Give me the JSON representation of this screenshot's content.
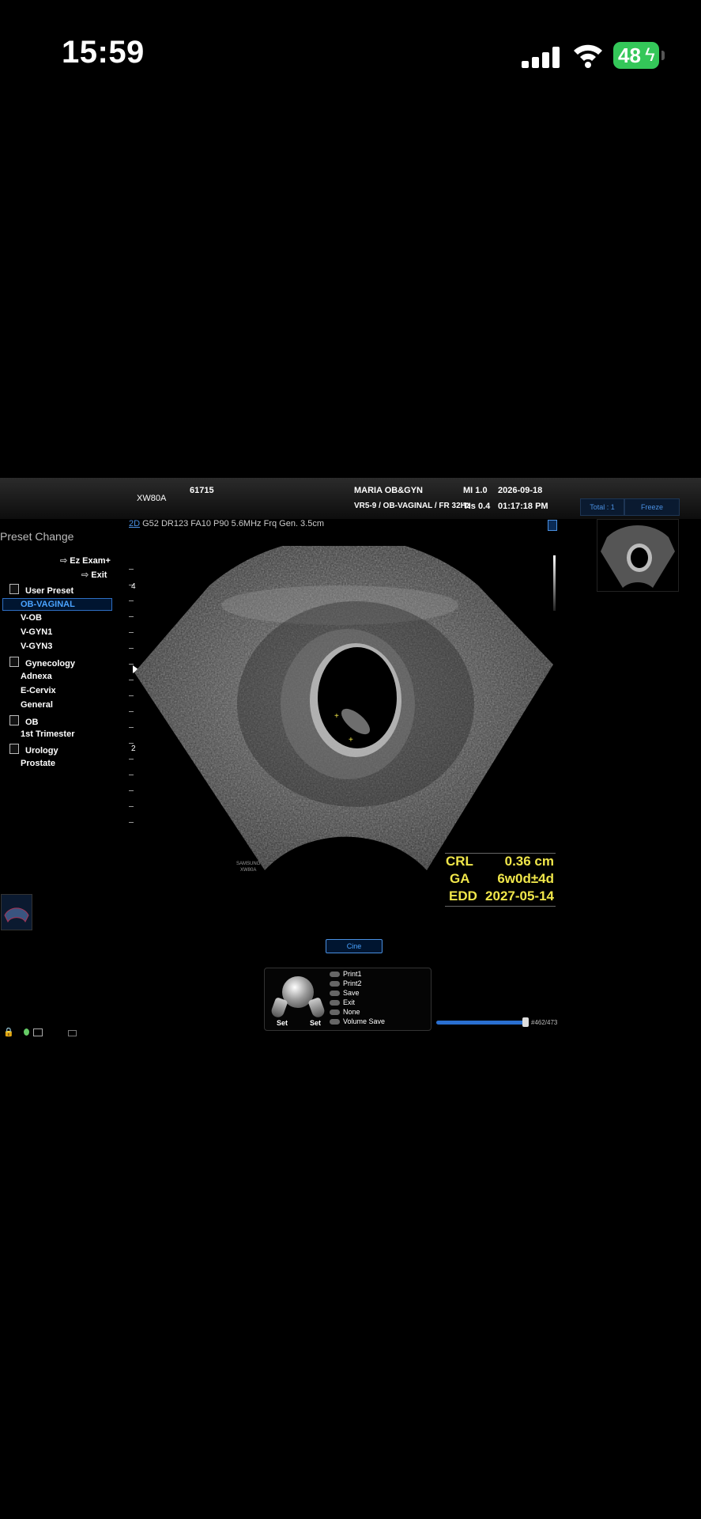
{
  "status_bar": {
    "time": "15:59",
    "battery": "48"
  },
  "header": {
    "model": "XW80A",
    "id": "61715",
    "institution": "MARIA OB&GYN",
    "probe_preset": "VR5-9 / OB-VAGINAL / FR 32Hz",
    "mi": "MI  1.0",
    "tis": "TIs 0.4",
    "date": "2026-09-18",
    "clock": "01:17:18 PM",
    "total_tab": "Total : 1",
    "freeze_tab": "Freeze"
  },
  "params": {
    "mode": "2D",
    "values": "G52 DR123 FA10 P90 5.6MHz Frq Gen. 3.5cm"
  },
  "preset_menu": {
    "title": "Preset Change",
    "ez_exam": "Ez Exam+",
    "exit": "Exit",
    "groups": [
      {
        "label": "User Preset",
        "items": [
          "OB-VAGINAL",
          "V-OB",
          "V-GYN1",
          "V-GYN3"
        ]
      },
      {
        "label": "Gynecology",
        "items": [
          "Adnexa",
          "E-Cervix",
          "General"
        ]
      },
      {
        "label": "OB",
        "items": [
          "1st Trimester"
        ]
      },
      {
        "label": "Urology",
        "items": [
          "Prostate"
        ]
      }
    ],
    "selected": "OB-VAGINAL"
  },
  "depth_scale": {
    "mark_4": "4",
    "mark_2": "2"
  },
  "watermark": {
    "line1": "SAMSUNG",
    "line2": "XW80A"
  },
  "measurements": [
    {
      "label": "CRL",
      "value": "0.36 cm"
    },
    {
      "label": "GA",
      "value": "6w0d±4d"
    },
    {
      "label": "EDD",
      "value": "2027-05-14"
    }
  ],
  "cine_button": "Cine",
  "control_panel": {
    "set_left": "Set",
    "set_right": "Set",
    "options": [
      "Print1",
      "Print2",
      "Save",
      "Exit",
      "None",
      "Volume Save"
    ]
  },
  "cine_counter": "#462/473",
  "colors": {
    "accent": "#4a90e2",
    "measure": "#f0e64a",
    "battery": "#34c759"
  }
}
